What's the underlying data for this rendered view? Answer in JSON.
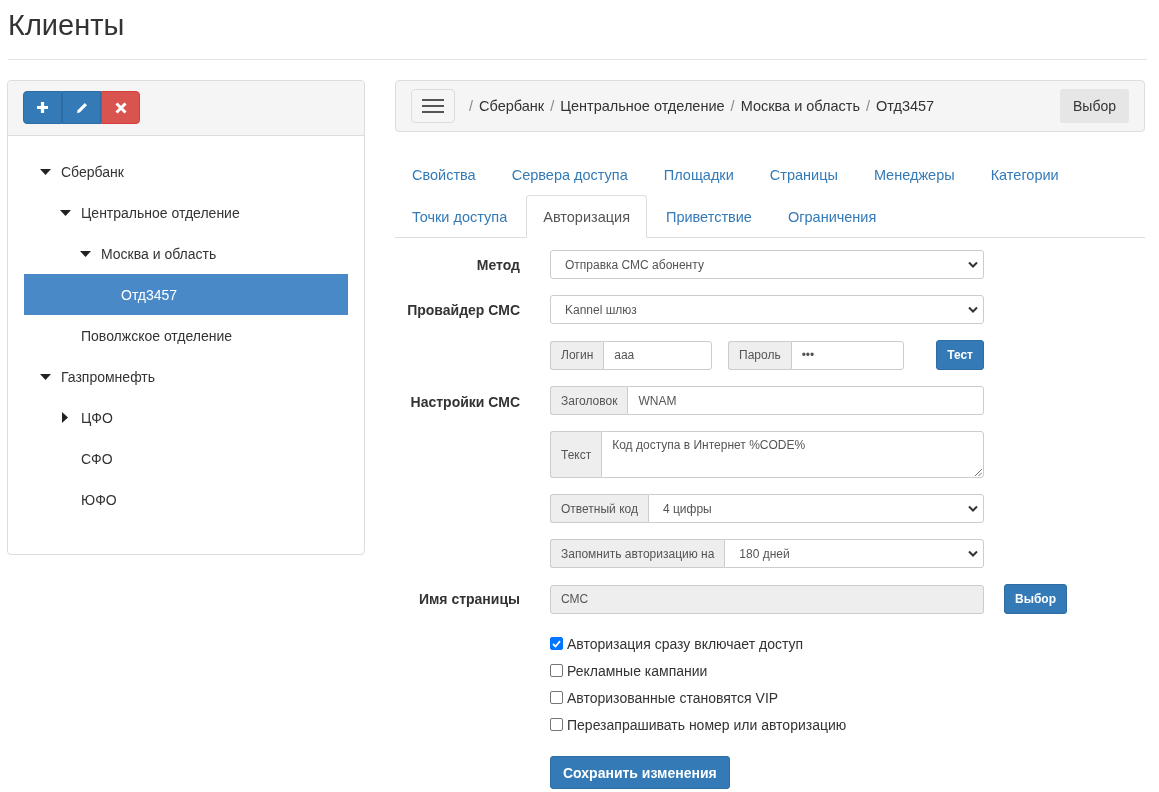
{
  "page": {
    "title": "Клиенты"
  },
  "toolbar": {
    "buttons": [
      {
        "kind": "add"
      },
      {
        "kind": "edit"
      },
      {
        "kind": "delete"
      }
    ]
  },
  "tree": [
    {
      "label": "Сбербанк",
      "expanded": true,
      "selected": false,
      "children": [
        {
          "label": "Центральное отделение",
          "expanded": true,
          "selected": false,
          "children": [
            {
              "label": "Москва и область",
              "expanded": true,
              "selected": false,
              "children": [
                {
                  "label": "Отд3457",
                  "selected": true
                }
              ]
            }
          ]
        },
        {
          "label": "Поволжское отделение",
          "selected": false
        }
      ]
    },
    {
      "label": "Газпромнефть",
      "expanded": true,
      "selected": false,
      "children": [
        {
          "label": "ЦФО",
          "expanded": false,
          "selected": false
        },
        {
          "label": "СФО",
          "selected": false
        },
        {
          "label": "ЮФО",
          "selected": false
        }
      ]
    }
  ],
  "breadcrumb": {
    "separator": "/",
    "items": [
      "Сбербанк",
      "Центральное отделение",
      "Москва и область",
      "Отд3457"
    ],
    "button": "Выбор"
  },
  "tabs": [
    {
      "label": "Свойства",
      "selected": false
    },
    {
      "label": "Сервера доступа",
      "selected": false
    },
    {
      "label": "Площадки",
      "selected": false
    },
    {
      "label": "Страницы",
      "selected": false
    },
    {
      "label": "Менеджеры",
      "selected": false
    },
    {
      "label": "Категории",
      "selected": false
    },
    {
      "label": "Точки доступа",
      "selected": false
    },
    {
      "label": "Авторизация",
      "selected": true
    },
    {
      "label": "Приветствие",
      "selected": false
    },
    {
      "label": "Ограничения",
      "selected": false
    }
  ],
  "form": {
    "rows": [
      {
        "kind": "select",
        "label": "Метод",
        "value": "Отправка СМС абоненту"
      },
      {
        "kind": "select",
        "label": "Провайдер СМС",
        "value": "Kannel шлюз"
      },
      {
        "kind": "credentials",
        "fields": [
          {
            "addon": "Логин",
            "value": "aaa"
          },
          {
            "addon": "Пароль",
            "value": "•••"
          }
        ],
        "button": "Тест"
      },
      {
        "kind": "addon_input",
        "label": "Настройки СМС",
        "addon": "Заголовок",
        "value": "WNAM"
      },
      {
        "kind": "addon_textarea",
        "addon": "Текст",
        "value": "Код доступа в Интернет %CODE%"
      },
      {
        "kind": "addon_select",
        "addon": "Ответный код",
        "value": "4 цифры"
      },
      {
        "kind": "addon_select",
        "addon": "Запомнить авторизацию на",
        "value": "180 дней"
      },
      {
        "kind": "readonly",
        "label": "Имя страницы",
        "value": "СМС",
        "button": "Выбор"
      }
    ],
    "checkboxes": [
      {
        "label": "Авторизация сразу включает доступ",
        "checked": true
      },
      {
        "label": "Рекламные кампании",
        "checked": false
      },
      {
        "label": "Авторизованные становятся VIP",
        "checked": false
      },
      {
        "label": "Перезапрашивать номер или авторизацию",
        "checked": false
      }
    ],
    "save_button": "Сохранить изменения"
  }
}
